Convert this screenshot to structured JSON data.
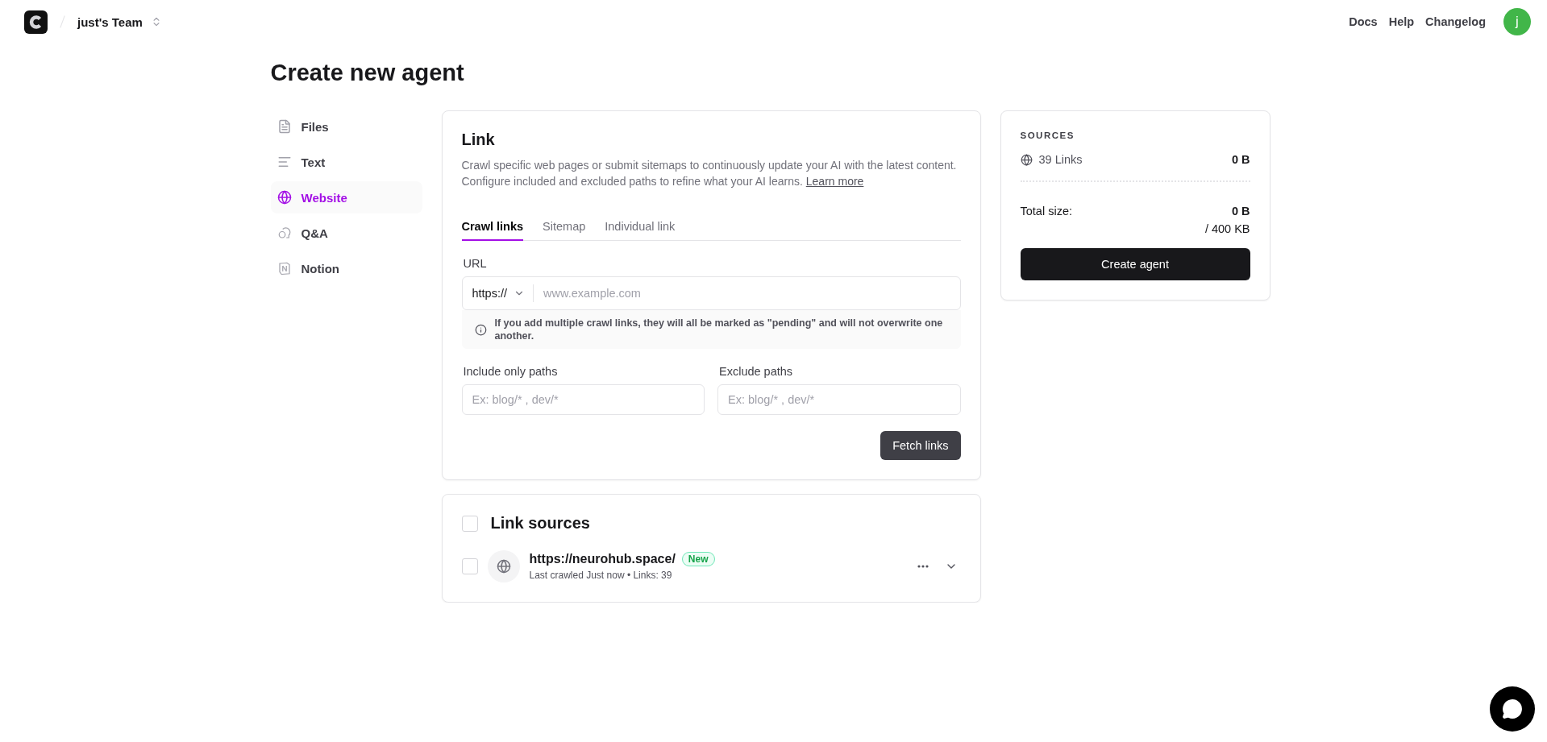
{
  "header": {
    "team": "just's Team",
    "nav_links": [
      "Docs",
      "Help",
      "Changelog"
    ],
    "avatar": "j"
  },
  "title": "Create new agent",
  "sidebar": {
    "items": [
      {
        "kind": "files",
        "label": "Files",
        "selected": false
      },
      {
        "kind": "text",
        "label": "Text",
        "selected": false
      },
      {
        "kind": "website",
        "label": "Website",
        "selected": true
      },
      {
        "kind": "qa",
        "label": "Q&A",
        "selected": false
      },
      {
        "kind": "notion",
        "label": "Notion",
        "selected": false
      }
    ]
  },
  "link_card": {
    "title": "Link",
    "description": "Crawl specific web pages or submit sitemaps to continuously update your AI with the latest content. Configure included and excluded paths to refine what your AI learns.",
    "learn_more": "Learn more",
    "tabs": [
      {
        "label": "Crawl links",
        "selected": true
      },
      {
        "label": "Sitemap",
        "selected": false
      },
      {
        "label": "Individual link",
        "selected": false
      }
    ],
    "url": {
      "label": "URL",
      "protocol": "https://",
      "placeholder": "www.example.com"
    },
    "notice": "If you add multiple crawl links, they will all be marked as \"pending\" and will not overwrite one another.",
    "include": {
      "label": "Include only paths",
      "placeholder": "Ex: blog/* , dev/*"
    },
    "exclude": {
      "label": "Exclude paths",
      "placeholder": "Ex: blog/* , dev/*"
    },
    "button": "Fetch links"
  },
  "link_sources": {
    "title": "Link sources",
    "checked": false,
    "items": [
      {
        "url": "https://neurohub.space/",
        "badge": "New",
        "meta": "Last crawled Just now • Links: 39",
        "checked": false
      }
    ]
  },
  "sources": {
    "heading": "SOURCES",
    "rows": [
      {
        "label": "39 Links",
        "size": "0 B"
      }
    ],
    "total_label": "Total size:",
    "total": "0 B",
    "limit": "/ 400 KB",
    "button": "Create agent"
  }
}
